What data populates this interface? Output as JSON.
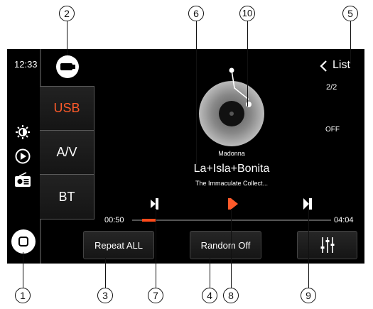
{
  "status": {
    "time": "12:33"
  },
  "sources": [
    {
      "label": "USB",
      "active": true
    },
    {
      "label": "A/V",
      "active": false
    },
    {
      "label": "BT",
      "active": false
    }
  ],
  "track": {
    "artist": "Madonna",
    "title": "La+Isla+Bonita",
    "album": "The Immaculate Collect..."
  },
  "list": {
    "label": "List",
    "count": "2/2"
  },
  "random_status": "OFF",
  "playback": {
    "elapsed": "00:50",
    "total": "04:04",
    "progress": 0.2
  },
  "buttons": {
    "repeat": "Repeat ALL",
    "random": "Random Off"
  },
  "callouts": {
    "c1": "1",
    "c2": "2",
    "c3": "3",
    "c4": "4",
    "c5": "5",
    "c6": "6",
    "c7": "7",
    "c8": "8",
    "c9": "9",
    "c10": "10"
  },
  "colors": {
    "accent": "#ff5a2a",
    "background": "#000000",
    "text": "#ffffff"
  },
  "icons": [
    "usb-icon",
    "brightness-icon",
    "play-circle-icon",
    "radio-icon",
    "home-icon",
    "chevron-left-icon",
    "previous-track-icon",
    "play-icon",
    "next-track-icon",
    "equalizer-icon",
    "vinyl-record-icon"
  ]
}
